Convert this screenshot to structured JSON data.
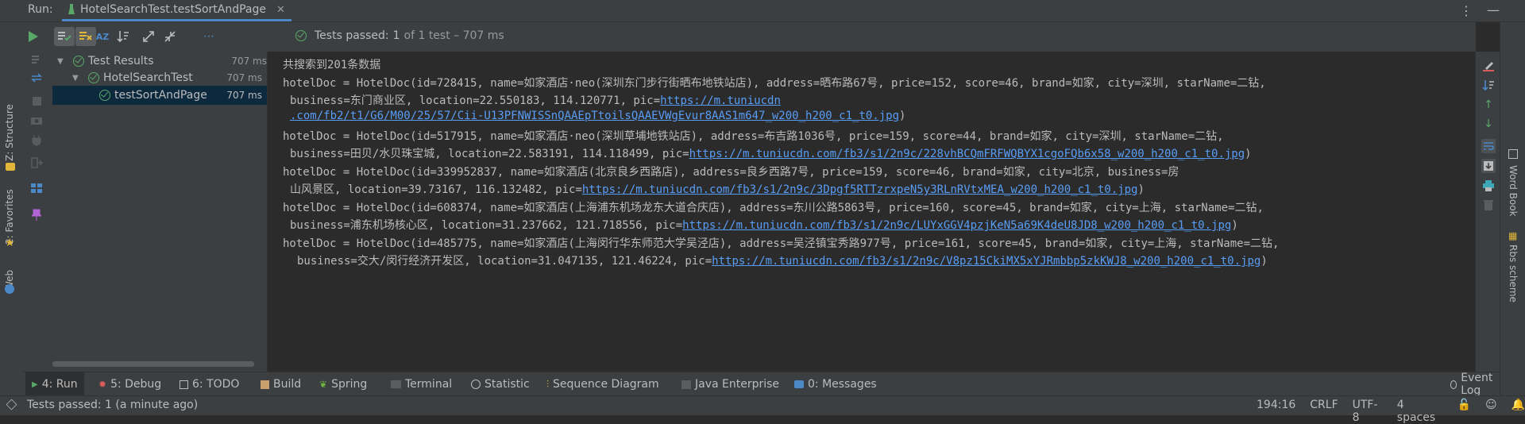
{
  "run": {
    "label": "Run:",
    "tab_title": "HotelSearchTest.testSortAndPage"
  },
  "toolbar": {
    "status_prefix": "Tests passed:",
    "status_count": "1",
    "status_suffix": "of 1 test – 707 ms",
    "more": "⋯"
  },
  "tree": {
    "rows": [
      {
        "label": "Test Results",
        "time": "707 ms"
      },
      {
        "label": "HotelSearchTest",
        "time": "707 ms"
      },
      {
        "label": "testSortAndPage",
        "time": "707 ms"
      }
    ]
  },
  "console": {
    "lines": [
      {
        "text": "共搜索到201条数据",
        "link": ""
      },
      {
        "text": "hotelDoc = HotelDoc(id=728415, name=如家酒店·neo(深圳东门步行街晒布地铁站店), address=晒布路67号, price=152, score=46, brand=如家, city=深圳, starName=二钻,",
        "link": ""
      },
      {
        "text": "business=东门商业区, location=22.550183, 114.120771, pic=",
        "link": "https://m.tuniucdn"
      },
      {
        "text": "",
        "link": ".com/fb2/t1/G6/M00/25/57/Cii-U13PFNWISSnQAAEpTtoilsQAAEVWgEvur8AAS1m647_w200_h200_c1_t0.jpg",
        "tail": ")"
      },
      {
        "text": "hotelDoc = HotelDoc(id=517915, name=如家酒店·neo(深圳草埔地铁站店), address=布吉路1036号, price=159, score=44, brand=如家, city=深圳, starName=二钻,",
        "link": ""
      },
      {
        "text": "business=田贝/水贝珠宝城, location=22.583191, 114.118499, pic=",
        "link": "https://m.tuniucdn.com/fb3/s1/2n9c/228vhBCQmFRFWQBYX1cgoFQb6x58_w200_h200_c1_t0.jpg",
        "tail": ")"
      },
      {
        "text": "hotelDoc = HotelDoc(id=339952837, name=如家酒店(北京良乡西路店), address=良乡西路7号, price=159, score=46, brand=如家, city=北京, business=房",
        "link": ""
      },
      {
        "text": "山风景区, location=39.73167, 116.132482, pic=",
        "link": "https://m.tuniucdn.com/fb3/s1/2n9c/3Dpgf5RTTzrxpeN5y3RLnRVtxMEA_w200_h200_c1_t0.jpg",
        "tail": ")"
      },
      {
        "text": "hotelDoc = HotelDoc(id=608374, name=如家酒店(上海浦东机场龙东大道合庆店), address=东川公路5863号, price=160, score=45, brand=如家, city=上海, starName=二钻,",
        "link": ""
      },
      {
        "text": "business=浦东机场核心区, location=31.237662, 121.718556, pic=",
        "link": "https://m.tuniucdn.com/fb3/s1/2n9c/LUYxGGV4pzjKeN5a69K4deU8JD8_w200_h200_c1_t0.jpg",
        "tail": ")"
      },
      {
        "text": "hotelDoc = HotelDoc(id=485775, name=如家酒店(上海闵行华东师范大学吴泾店), address=吴泾镇宝秀路977号, price=161, score=45, brand=如家, city=上海, starName=二钻,",
        "link": ""
      },
      {
        "text": "business=交大/闵行经济开发区, location=31.047135, 121.46224, pic=",
        "link": "https://m.tuniucdn.com/fb3/s1/2n9c/V8pz15CkiMX5xYJRmbbp5zkKWJ8_w200_h200_c1_t0.jpg",
        "tail": ")"
      }
    ]
  },
  "left_sidebar": {
    "structure": "Z: Structure",
    "favorites": "2: Favorites",
    "web": "Web"
  },
  "right_sidebar": {
    "word_book": "Word Book",
    "rbs_scheme": "Rbs scheme"
  },
  "bottom_tabs": [
    {
      "label": "4: Run"
    },
    {
      "label": "5: Debug"
    },
    {
      "label": "6: TODO"
    },
    {
      "label": "Build"
    },
    {
      "label": "Spring"
    },
    {
      "label": "Terminal"
    },
    {
      "label": "Statistic"
    },
    {
      "label": "Sequence Diagram"
    },
    {
      "label": "Java Enterprise"
    },
    {
      "label": "0: Messages"
    }
  ],
  "event_log": "Event Log",
  "status": {
    "message": "Tests passed: 1 (a minute ago)",
    "position": "194:16",
    "line_sep": "CRLF",
    "encoding": "UTF-8",
    "indent": "4 spaces"
  },
  "colors": {
    "pass_green": "#59a869",
    "link_blue": "#589df6",
    "selection": "#0d293e",
    "accent": "#4a88c7"
  }
}
